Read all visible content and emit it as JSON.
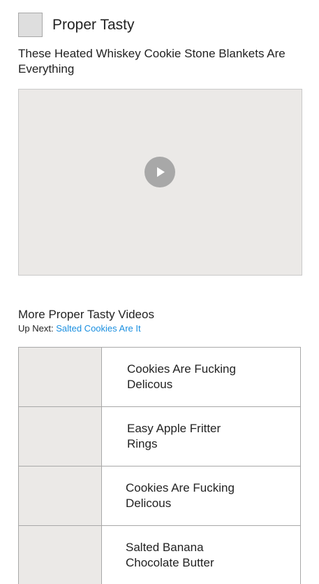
{
  "header": {
    "channel_name": "Proper Tasty"
  },
  "video": {
    "title": "These Heated Whiskey Cookie Stone Blankets Are Everything",
    "play_icon": "play-icon"
  },
  "more": {
    "title": "More Proper Tasty Videos",
    "up_next_label": "Up Next:",
    "up_next_link": "Salted Cookies Are It"
  },
  "list": [
    {
      "title": "Cookies Are Fucking Delicous"
    },
    {
      "title": "Easy Apple Fritter Rings"
    },
    {
      "title": "Cookies Are Fucking Delicous"
    },
    {
      "title": "Salted Banana Chocolate Butter"
    }
  ],
  "colors": {
    "link": "#1a8fe0",
    "placeholder_bg": "#ebe9e7",
    "border": "#a8a8a8"
  }
}
